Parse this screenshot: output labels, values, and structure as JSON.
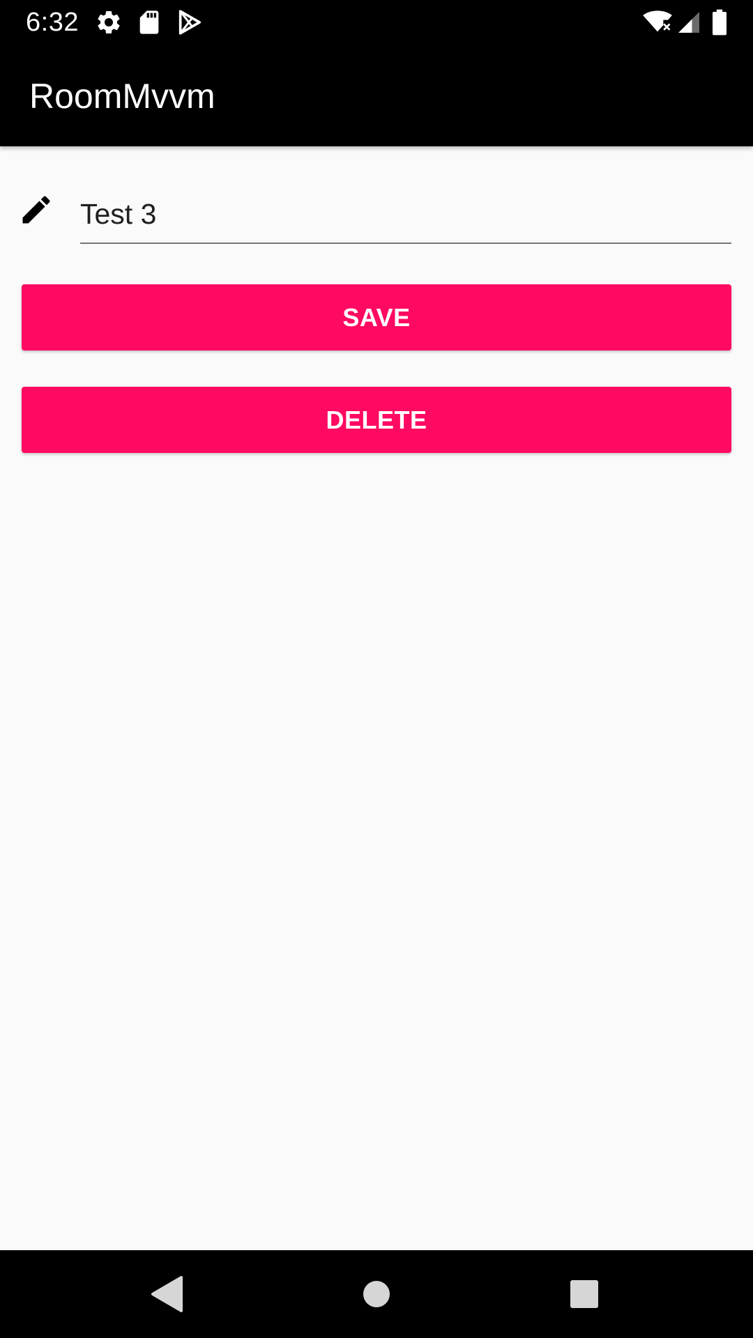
{
  "status_bar": {
    "time": "6:32",
    "left_icons": [
      "gear-icon",
      "sd-card-icon",
      "play-store-icon"
    ],
    "right_icons": [
      "wifi-no-internet-icon",
      "cell-signal-icon",
      "battery-icon"
    ]
  },
  "app_bar": {
    "title": "RoomMvvm"
  },
  "form": {
    "field_icon": "pencil-icon",
    "field_value": "Test 3"
  },
  "buttons": {
    "save_label": "SAVE",
    "delete_label": "DELETE"
  },
  "nav_bar": {
    "icons": [
      "back-icon",
      "home-icon",
      "recents-icon"
    ]
  },
  "colors": {
    "accent": "#ff0a63",
    "app_bar": "#000000",
    "background": "#fafafa"
  }
}
